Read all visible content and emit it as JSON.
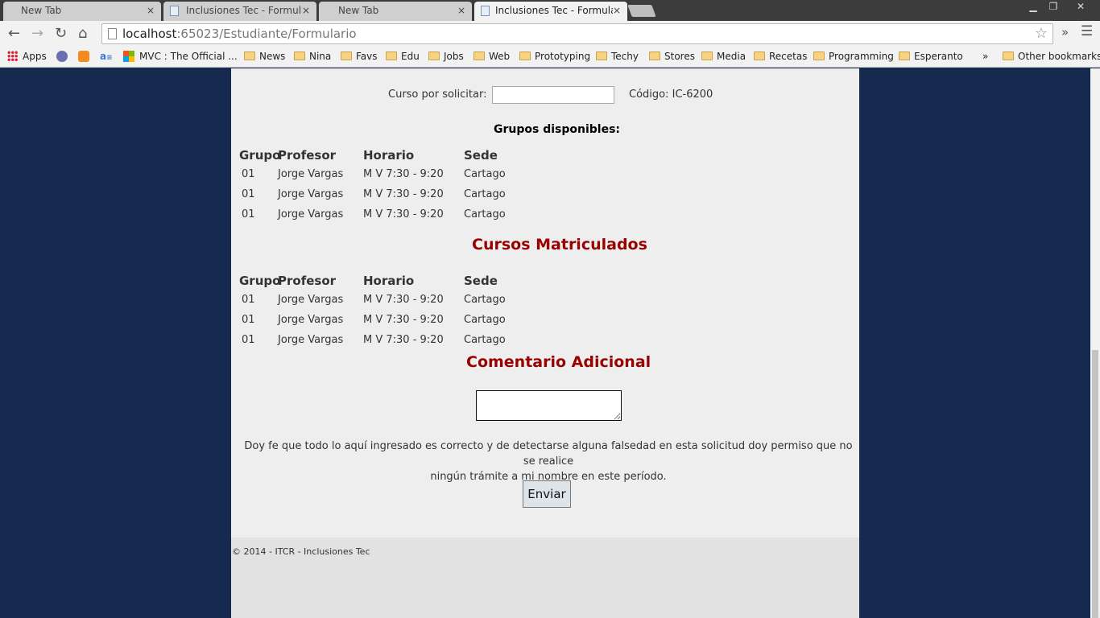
{
  "browser": {
    "tabs": [
      {
        "title": "New Tab",
        "active": false,
        "has_icon": false
      },
      {
        "title": "Inclusiones Tec - Formula",
        "active": false,
        "has_icon": true
      },
      {
        "title": "New Tab",
        "active": false,
        "has_icon": false
      },
      {
        "title": "Inclusiones Tec - Formula",
        "active": true,
        "has_icon": true
      }
    ],
    "tab_close": "×",
    "window_controls": {
      "minimize": "▁",
      "maximize": "❐",
      "close": "✕"
    },
    "url_host": "localhost",
    "url_rest": ":65023/Estudiante/Formulario",
    "bookmarks": [
      "Apps",
      "MVC : The Official ...",
      "News",
      "Nina",
      "Favs",
      "Edu",
      "Jobs",
      "Web",
      "Prototyping",
      "Techy",
      "Stores",
      "Media",
      "Recetas",
      "Programming",
      "Esperanto"
    ],
    "bookmarks_overflow": "»",
    "other_bookmarks": "Other bookmarks"
  },
  "form": {
    "course_label": "Curso por solicitar:",
    "course_value": "",
    "code_text": "Código: IC-6200",
    "groups_title": "Grupos disponibles:",
    "headers": [
      "Grupo",
      "Profesor",
      "Horario",
      "Sede"
    ],
    "available_groups": [
      [
        "01",
        "Jorge Vargas",
        "M V 7:30 - 9:20",
        "Cartago"
      ],
      [
        "01",
        "Jorge Vargas",
        "M V 7:30 - 9:20",
        "Cartago"
      ],
      [
        "01",
        "Jorge Vargas",
        "M V 7:30 - 9:20",
        "Cartago"
      ]
    ],
    "enrolled_title": "Cursos Matriculados",
    "enrolled_groups": [
      [
        "01",
        "Jorge Vargas",
        "M V 7:30 - 9:20",
        "Cartago"
      ],
      [
        "01",
        "Jorge Vargas",
        "M V 7:30 - 9:20",
        "Cartago"
      ],
      [
        "01",
        "Jorge Vargas",
        "M V 7:30 - 9:20",
        "Cartago"
      ]
    ],
    "comment_title": "Comentario Adicional",
    "comment_value": "",
    "note_line1": "Doy fe que todo lo aquí ingresado es correcto y de detectarse alguna falsedad en esta solicitud doy permiso que no se realice",
    "note_line2": "ningún trámite a mi nombre en este período.",
    "submit_label": "Enviar"
  },
  "footer": {
    "text": "© 2014 - ITCR - Inclusiones Tec"
  },
  "colors": {
    "page_bg": "#16294f",
    "content_bg": "#eeeeee",
    "section_title": "#990000"
  }
}
